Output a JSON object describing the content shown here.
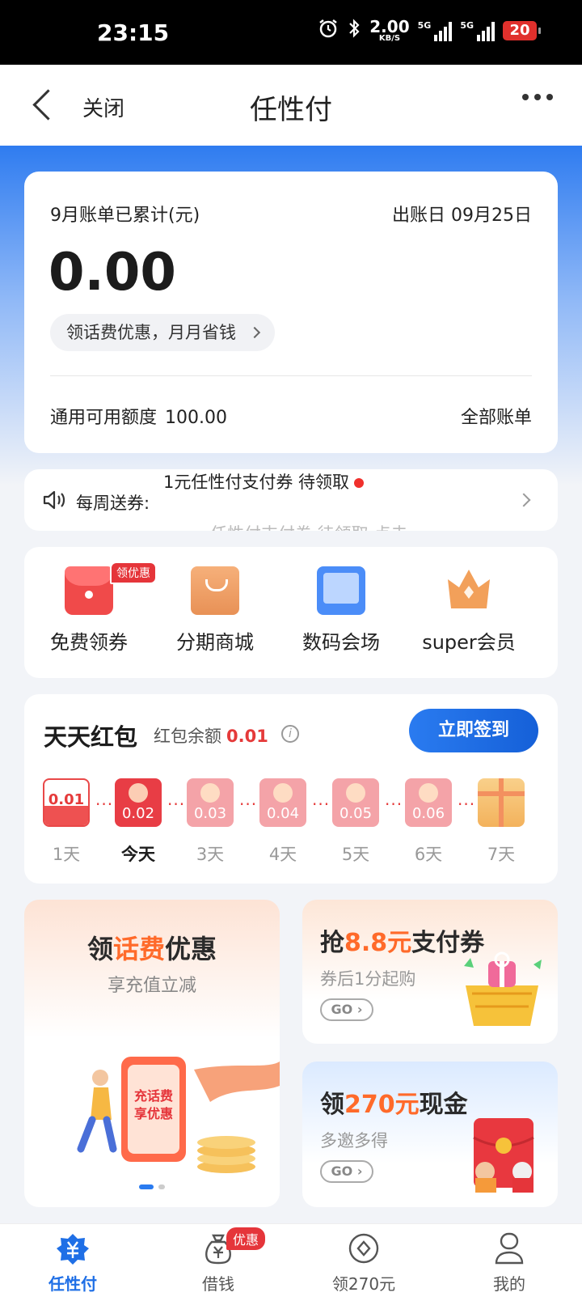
{
  "status_bar": {
    "time": "23:15",
    "net_speed": "2.00",
    "net_unit": "KB/S",
    "signal1_label": "5G",
    "signal2_label": "5G",
    "battery": "20"
  },
  "nav": {
    "close_label": "关闭",
    "title": "任性付"
  },
  "bill": {
    "label": "9月账单已累计(元)",
    "due_date": "出账日 09月25日",
    "amount": "0.00",
    "promo_pill": "领话费优惠，月月省钱",
    "credit_label": "通用可用额度",
    "credit_value": "100.00",
    "all_bills": "全部账单"
  },
  "weekly": {
    "label": "每周送券:",
    "notice": "1元任性付支付券 待领取",
    "ghost_text": "任性付支付券 待领取 点击"
  },
  "entries": [
    {
      "label": "免费领券",
      "tag": "领优惠",
      "icon": "coupon-icon"
    },
    {
      "label": "分期商城",
      "icon": "shopping-bag-icon"
    },
    {
      "label": "数码会场",
      "icon": "tablet-icon"
    },
    {
      "label": "super会员",
      "icon": "crown-icon"
    }
  ],
  "red_packet": {
    "title": "天天红包",
    "balance_label": "红包余额",
    "balance_value": "0.01",
    "checkin_button": "立即签到",
    "days": [
      {
        "value": "0.01",
        "label": "1天",
        "state": "claimed"
      },
      {
        "value": "0.02",
        "label": "今天",
        "state": "today"
      },
      {
        "value": "0.03",
        "label": "3天",
        "state": "future"
      },
      {
        "value": "0.04",
        "label": "4天",
        "state": "future"
      },
      {
        "value": "0.05",
        "label": "5天",
        "state": "future"
      },
      {
        "value": "0.06",
        "label": "6天",
        "state": "future"
      },
      {
        "value": "",
        "label": "7天",
        "state": "gift"
      }
    ]
  },
  "promos": {
    "left": {
      "title_pre": "领",
      "title_hl": "话费",
      "title_post": "优惠",
      "subtitle": "享充值立减",
      "art_text1": "充话费",
      "art_text2": "享优惠"
    },
    "right_top": {
      "title_pre": "抢",
      "title_hl": "8.8元",
      "title_post": "支付券",
      "subtitle": "券后1分起购",
      "go": "GO"
    },
    "right_bottom": {
      "title_pre": "领",
      "title_hl": "270元",
      "title_post": "现金",
      "subtitle": "多邀多得",
      "go": "GO"
    }
  },
  "tabs": [
    {
      "label": "任性付",
      "icon": "renxingfu-icon",
      "active": true
    },
    {
      "label": "借钱",
      "icon": "money-bag-icon",
      "badge": "优惠"
    },
    {
      "label": "领270元",
      "icon": "coin-icon"
    },
    {
      "label": "我的",
      "icon": "user-icon"
    }
  ],
  "colors": {
    "primary_blue": "#2a7bf0",
    "accent_red": "#e53a3a",
    "accent_orange": "#ff6a2a"
  }
}
